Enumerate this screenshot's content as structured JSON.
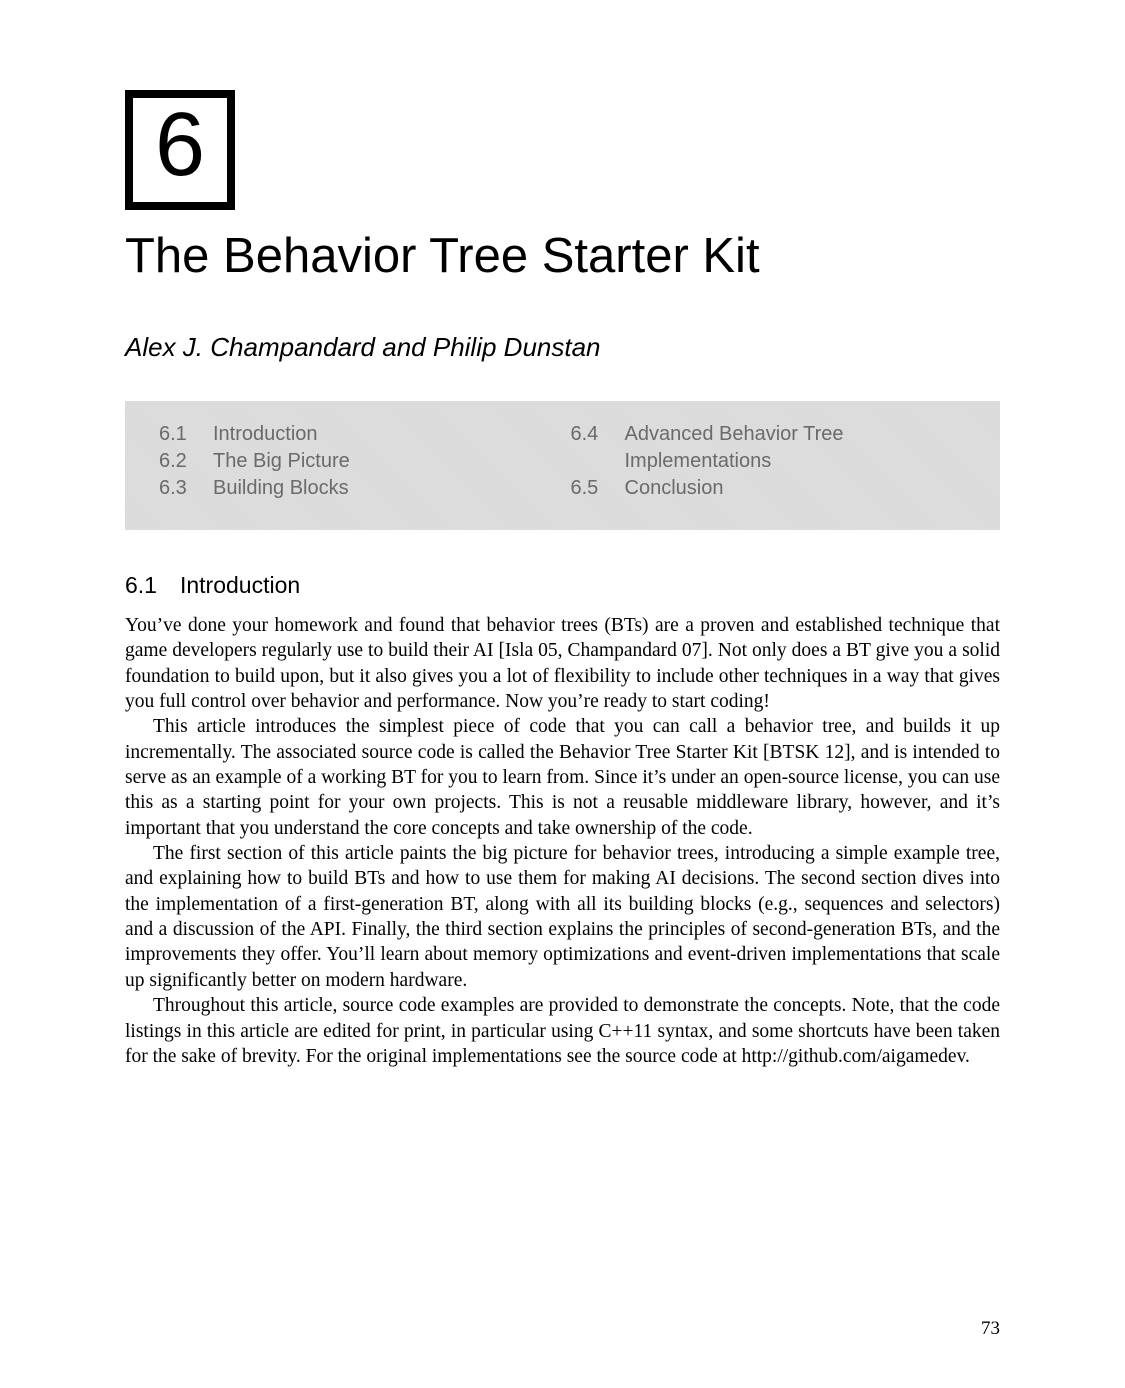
{
  "chapter": {
    "number": "6",
    "title": "The Behavior Tree Starter Kit",
    "authors": "Alex J. Champandard and Philip Dunstan"
  },
  "toc": {
    "left": [
      {
        "num": "6.1",
        "label": "Introduction"
      },
      {
        "num": "6.2",
        "label": "The Big Picture"
      },
      {
        "num": "6.3",
        "label": "Building Blocks"
      }
    ],
    "right": [
      {
        "num": "6.4",
        "label": "Advanced Behavior Tree",
        "sub": "Implementations"
      },
      {
        "num": "6.5",
        "label": "Conclusion"
      }
    ]
  },
  "section": {
    "heading": "6.1 Introduction",
    "p1": "You’ve done your homework and found that behavior trees (BTs) are a proven and established technique that game developers regularly use to build their AI [Isla 05, Champandard 07]. Not only does a BT give you a solid foundation to build upon, but it also gives you a lot of flexibility to include other techniques in a way that gives you full control over behavior and performance. Now you’re ready to start coding!",
    "p2": "This article introduces the simplest piece of code that you can call a behavior tree, and builds it up incrementally. The associated source code is called the Behavior Tree Starter Kit [BTSK 12], and is intended to serve as an example of a working BT for you to learn from. Since it’s under an open-source license, you can use this as a starting point for your own projects. This is not a reusable middleware library, however, and it’s important that you understand the core concepts and take ownership of the code.",
    "p3": "The first section of this article paints the big picture for behavior trees, introducing a simple example tree, and explaining how to build BTs and how to use them for making AI decisions. The second section dives into the implementation of a first-generation BT, along with all its building blocks (e.g., sequences and selectors) and a discussion of the API. Finally, the third section explains the principles of second-generation BTs, and the improvements they offer. You’ll learn about memory optimizations and event-driven implementations that scale up significantly better on modern hardware.",
    "p4": "Throughout this article, source code examples are provided to demonstrate the concepts. Note, that the code listings in this article are edited for print, in particular using C++11 syntax, and some shortcuts have been taken for the sake of brevity. For the original implementations see the source code at http://github.com/aigamedev."
  },
  "page_number": "73"
}
